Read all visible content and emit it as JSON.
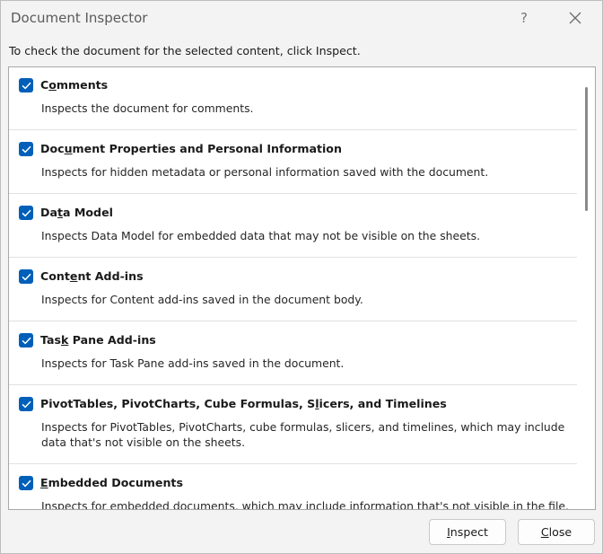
{
  "window": {
    "title": "Document Inspector",
    "help_label": "?"
  },
  "instruction": "To check the document for the selected content, click Inspect.",
  "items": [
    {
      "title_parts": [
        "C",
        "o",
        "mments"
      ],
      "checked": true,
      "description": "Inspects the document for comments."
    },
    {
      "title_parts": [
        "Doc",
        "u",
        "ment Properties and Personal Information"
      ],
      "checked": true,
      "description": "Inspects for hidden metadata or personal information saved with the document."
    },
    {
      "title_parts": [
        "Da",
        "t",
        "a Model"
      ],
      "checked": true,
      "description": "Inspects Data Model for embedded data that may not be visible on the sheets."
    },
    {
      "title_parts": [
        "Cont",
        "e",
        "nt Add-ins"
      ],
      "checked": true,
      "description": "Inspects for Content add-ins saved in the document body."
    },
    {
      "title_parts": [
        "Tas",
        "k",
        " Pane Add-ins"
      ],
      "checked": true,
      "description": "Inspects for Task Pane add-ins saved in the document."
    },
    {
      "title_parts": [
        "PivotTables, PivotCharts, Cube Formulas, S",
        "l",
        "icers, and Timelines"
      ],
      "checked": true,
      "description": "Inspects for PivotTables, PivotCharts, cube formulas, slicers, and timelines, which may include data that's not visible on the sheets."
    },
    {
      "title_parts": [
        "",
        "E",
        "mbedded Documents"
      ],
      "checked": true,
      "description": "Inspects for embedded documents, which may include information that's not visible in the file."
    }
  ],
  "buttons": {
    "inspect_parts": [
      "",
      "I",
      "nspect"
    ],
    "close_parts": [
      "",
      "C",
      "lose"
    ]
  },
  "colors": {
    "checkbox": "#005fb8"
  },
  "icons": {
    "checkbox": "checkmark-icon",
    "close": "close-icon"
  }
}
